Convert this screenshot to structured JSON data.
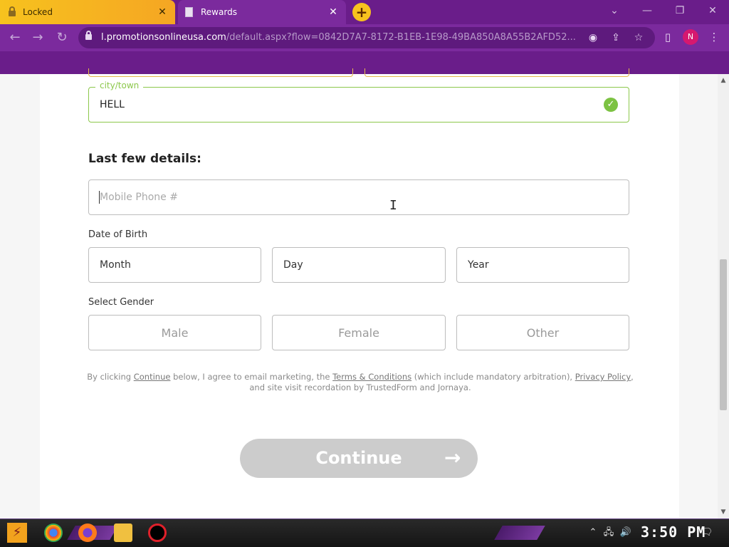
{
  "browser": {
    "tabs": [
      {
        "title": "Locked",
        "close": "✕"
      },
      {
        "title": "Rewards",
        "close": "✕"
      }
    ],
    "new_tab": "+",
    "window_controls": {
      "dropdown": "⌄",
      "minimize": "—",
      "restore": "❐",
      "close": "✕"
    },
    "nav": {
      "back": "←",
      "forward": "→",
      "reload": "↻"
    },
    "url_host": "l.promotionsonlineusa.com",
    "url_rest": "/default.aspx?flow=0842D7A7-8172-B1EB-1E98-49BA850A8A55B2AFD52...",
    "profile_initial": "N",
    "menu": "⋮"
  },
  "form": {
    "city_legend": "city/town",
    "city_value": "HELL",
    "check_glyph": "✓",
    "section_title": "Last few details:",
    "phone_placeholder": "Mobile Phone #",
    "dob_label": "Date of Birth",
    "dob_fields": [
      "Month",
      "Day",
      "Year"
    ],
    "gender_label": "Select Gender",
    "gender_options": [
      "Male",
      "Female",
      "Other"
    ],
    "legal": {
      "part1": "By clicking ",
      "continue_link": "Continue",
      "part2": " below, I agree to email marketing, the ",
      "terms_link": "Terms & Conditions",
      "part3": " (which include mandatory arbitration), ",
      "privacy_link": "Privacy Policy",
      "part4": ", and site visit recordation by TrustedForm and Jornaya."
    },
    "continue_label": "Continue",
    "continue_arrow": "→"
  },
  "taskbar": {
    "clock": "3:50 PM",
    "tray_up": "⌃",
    "tray_network": "🖧",
    "tray_volume": "🔊",
    "tray_notifications": "🗨"
  },
  "colors": {
    "valid_green": "#8cc84b",
    "browser_purple": "#7b2a9d",
    "button_disabled": "#cccccc"
  },
  "icons": [
    "lock-icon",
    "page-icon",
    "check-circle-icon",
    "arrow-right-icon",
    "text-cursor-icon"
  ]
}
